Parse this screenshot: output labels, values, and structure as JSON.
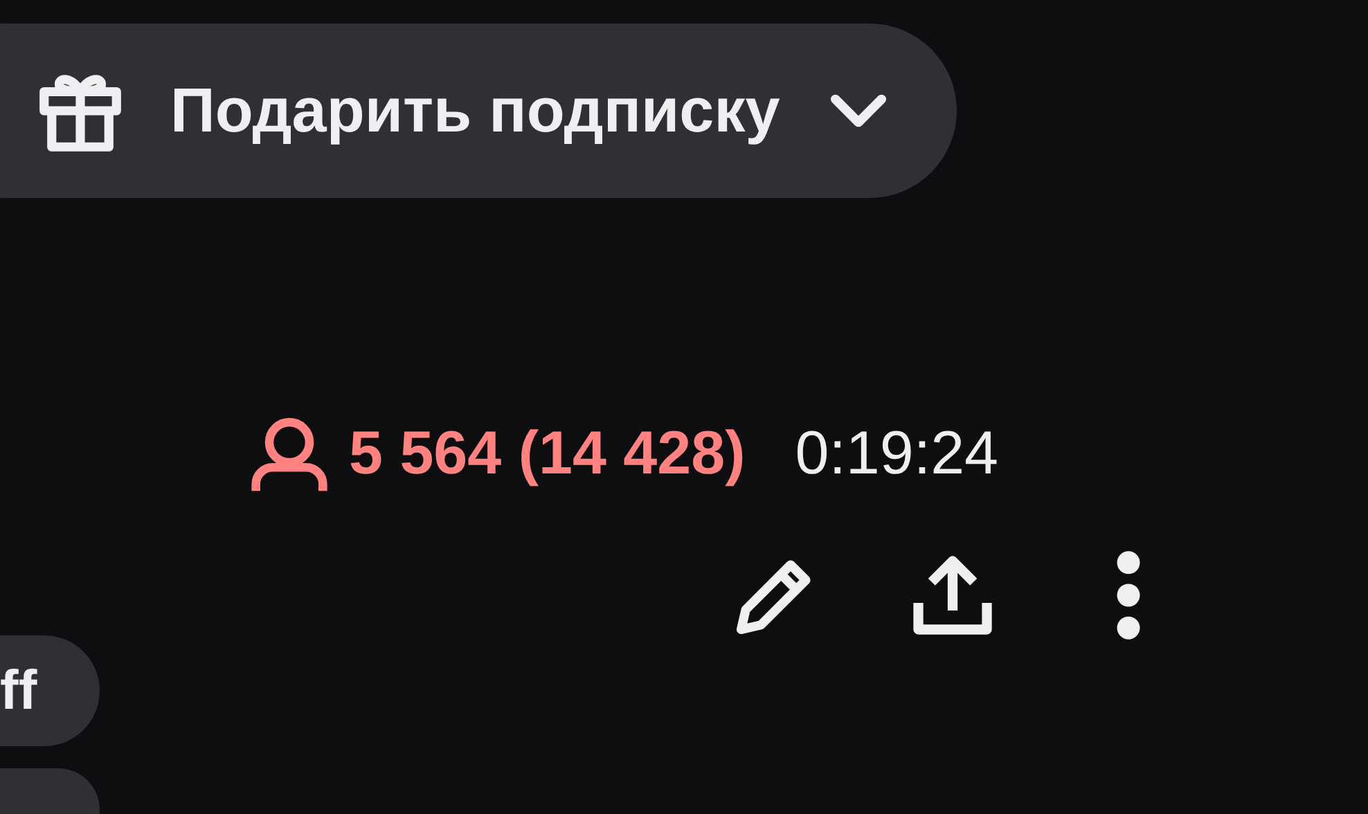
{
  "gift_button": {
    "label": "Подарить подписку"
  },
  "viewers": {
    "count": "5 564 (14 428)"
  },
  "uptime": "0:19:24",
  "actions": [
    {
      "kind": "edit"
    },
    {
      "kind": "share"
    },
    {
      "kind": "more"
    }
  ],
  "tags": [
    {
      "kind": "text",
      "label": "ff"
    },
    {
      "kind": "blank"
    }
  ]
}
